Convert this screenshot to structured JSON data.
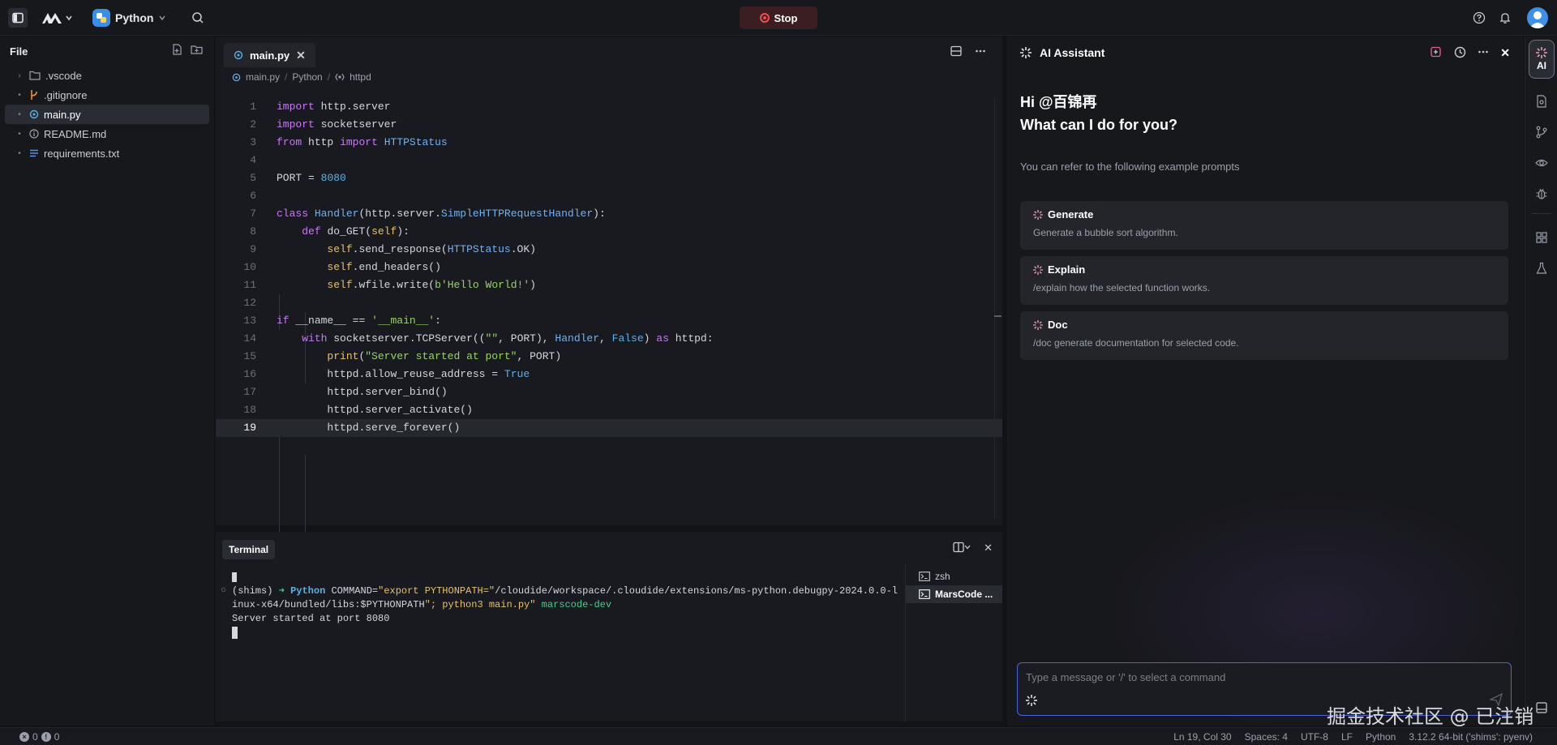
{
  "topbar": {
    "project_name": "Python",
    "stop_label": "Stop"
  },
  "explorer": {
    "title": "File",
    "items": [
      {
        "label": ".vscode",
        "kind": "folder"
      },
      {
        "label": ".gitignore",
        "kind": "git"
      },
      {
        "label": "main.py",
        "kind": "python",
        "active": true
      },
      {
        "label": "README.md",
        "kind": "info"
      },
      {
        "label": "requirements.txt",
        "kind": "text"
      }
    ]
  },
  "editor": {
    "tab_label": "main.py",
    "breadcrumb": [
      "main.py",
      "Python",
      "httpd"
    ],
    "current_line": 19,
    "lines": [
      {
        "n": "1"
      },
      {
        "n": "2"
      },
      {
        "n": "3"
      },
      {
        "n": "4"
      },
      {
        "n": "5"
      },
      {
        "n": "6"
      },
      {
        "n": "7"
      },
      {
        "n": "8"
      },
      {
        "n": "9"
      },
      {
        "n": "10"
      },
      {
        "n": "11"
      },
      {
        "n": "12"
      },
      {
        "n": "13"
      },
      {
        "n": "14"
      },
      {
        "n": "15"
      },
      {
        "n": "16"
      },
      {
        "n": "17"
      },
      {
        "n": "18"
      },
      {
        "n": "19"
      }
    ],
    "code": [
      "import http.server",
      "import socketserver",
      "from http import HTTPStatus",
      "",
      "PORT = 8080",
      "",
      "class Handler(http.server.SimpleHTTPRequestHandler):",
      "    def do_GET(self):",
      "        self.send_response(HTTPStatus.OK)",
      "        self.end_headers()",
      "        self.wfile.write(b'Hello World!')",
      "",
      "if __name__ == '__main__':",
      "    with socketserver.TCPServer((\"\", PORT), Handler, False) as httpd:",
      "        print(\"Server started at port\", PORT)",
      "        httpd.allow_reuse_address = True",
      "        httpd.server_bind()",
      "        httpd.server_activate()",
      "        httpd.serve_forever()"
    ]
  },
  "terminal": {
    "tab_label": "Terminal",
    "prompt_env": "(shims)",
    "prompt_arrow": "➜",
    "prompt_dir": "Python",
    "command_part1": "COMMAND=",
    "command_str1": "\"export PYTHONPATH=\"",
    "command_part2": "/cloudide/workspace/.cloudide/extensions/ms-python.debugpy-2024.0.0-l",
    "command_line2a": "inux-x64/bundled/libs:$PYTHONPATH",
    "command_line2b": "\"; python3 main.py\"",
    "branch": "marscode-dev",
    "output": "Server started at port 8080",
    "sessions": [
      {
        "label": "zsh"
      },
      {
        "label": "MarsCode ...",
        "active": true
      }
    ]
  },
  "ai": {
    "title": "AI Assistant",
    "greeting_line1": "Hi @百锦再",
    "greeting_line2": "What can I do for you?",
    "refer_text": "You can refer to the following example prompts",
    "prompts": [
      {
        "title": "Generate",
        "desc": "Generate a bubble sort algorithm."
      },
      {
        "title": "Explain",
        "desc": "/explain how the selected function works."
      },
      {
        "title": "Doc",
        "desc": "/doc generate documentation for selected code."
      }
    ],
    "input_placeholder": "Type a message or '/' to select a command",
    "activity_ai_label": "AI"
  },
  "watermark": "掘金技术社区 @ 已注销",
  "statusbar": {
    "errors": "0",
    "warnings": "0",
    "position": "Ln 19, Col 30",
    "spaces": "Spaces: 4",
    "encoding": "UTF-8",
    "eol": "LF",
    "language": "Python",
    "interpreter": "3.12.2 64-bit ('shims': pyenv)"
  },
  "colors": {
    "accent_blue": "#4a63d8",
    "stop_red": "#f04b4b",
    "python_blue": "#3a8ee6"
  }
}
